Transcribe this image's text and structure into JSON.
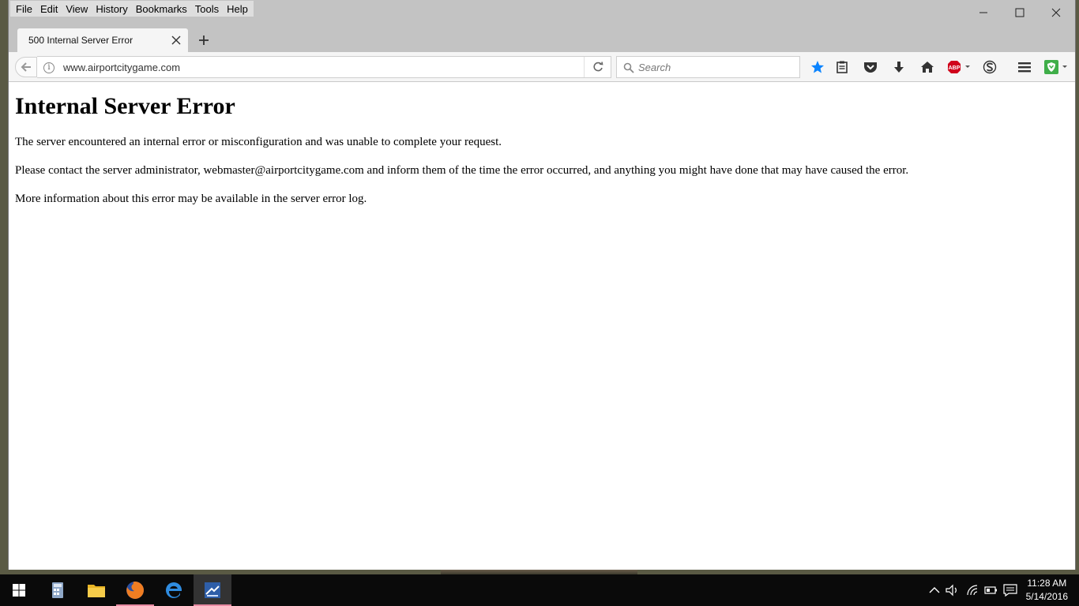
{
  "menu": [
    "File",
    "Edit",
    "View",
    "History",
    "Bookmarks",
    "Tools",
    "Help"
  ],
  "tab": {
    "title": "500 Internal Server Error"
  },
  "navbar": {
    "url": "www.airportcitygame.com",
    "search_placeholder": "Search"
  },
  "page": {
    "heading": "Internal Server Error",
    "paragraphs": [
      "The server encountered an internal error or misconfiguration and was unable to complete your request.",
      "Please contact the server administrator, webmaster@airportcitygame.com and inform them of the time the error occurred, and anything you might have done that may have caused the error.",
      "More information about this error may be available in the server error log."
    ]
  },
  "toolbar_icons": [
    "bookmark-star-icon",
    "reading-list-icon",
    "pocket-icon",
    "download-icon",
    "home-icon",
    "adblock-icon",
    "s-extension-icon",
    "hamburger-menu-icon",
    "extension-shield-icon"
  ],
  "taskbar": {
    "apps": [
      "windows-start",
      "calculator",
      "file-explorer",
      "firefox",
      "edge",
      "active-app"
    ],
    "time": "11:28 AM",
    "date": "5/14/2016"
  },
  "colors": {
    "accent_blue": "#0a84ff",
    "abp_red": "#d0021b",
    "taskbar": "#0a0a0a"
  }
}
